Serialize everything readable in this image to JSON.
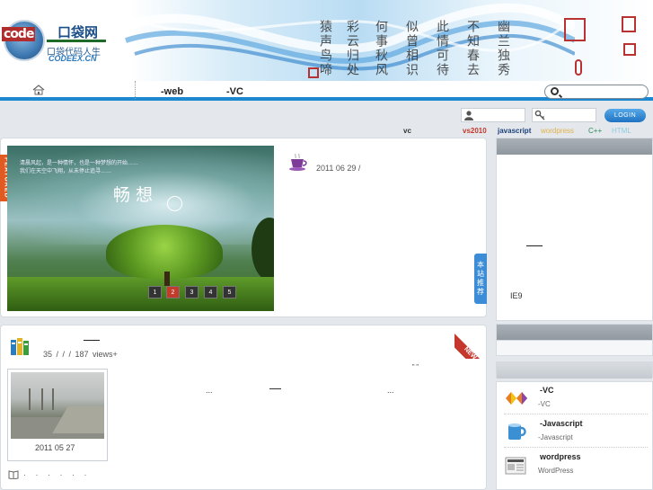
{
  "site": {
    "logo_code": "code",
    "logo_cn": "口袋网",
    "logo_sub": "口袋代码人生",
    "logo_url": "CODEEX.CN"
  },
  "header": {
    "calligraphy": [
      "猿声鸟啼",
      "彩云归处",
      "何事秋风",
      "似曾相识",
      "此情可待",
      "不知春去",
      "幽兰独秀"
    ]
  },
  "nav": {
    "items": [
      "-web",
      "-VC"
    ],
    "search_placeholder": ""
  },
  "login": {
    "button": "LOGIN"
  },
  "tags": [
    {
      "label": "vc",
      "color": "#333333"
    },
    {
      "label": "vs2010",
      "color": "#c0392b"
    },
    {
      "label": "javascript",
      "color": "#1b3f7a"
    },
    {
      "label": "wordpress",
      "color": "#e0b24a"
    },
    {
      "label": "C++",
      "color": "#2e8b57"
    },
    {
      "label": "HTML",
      "color": "#8ecbe0"
    }
  ],
  "featured": {
    "ribbon": "FEATURED",
    "slide_title": "畅想",
    "slide_small": [
      "清晨风起，是一种情怀，也是一种梦想的开始……",
      "我们在天空中飞翔，从未停止追寻……"
    ],
    "dots": [
      "1",
      "2",
      "3",
      "4",
      "5"
    ],
    "active_dot": 2,
    "date": "2011 06 29 /",
    "recommend_tab": "本站推荐"
  },
  "sidebar_top": {
    "text": "IE9"
  },
  "list": {
    "ribbon": "NEW",
    "meta": "35  /     /   /   187 views+",
    "thumb_date": "2011 05 27",
    "ellipsis_1": "...",
    "ellipsis_2": "...",
    "quote": "\" \"",
    "dots": "· · · · · ·"
  },
  "sidebar_list": [
    {
      "title": "-VC",
      "sub": "-VC",
      "icon": "vs-logo-icon"
    },
    {
      "title": "-Javascript",
      "sub": "-Javascript",
      "icon": "mug-icon"
    },
    {
      "title": "wordpress",
      "sub": "WordPress",
      "icon": "newspaper-icon"
    }
  ]
}
